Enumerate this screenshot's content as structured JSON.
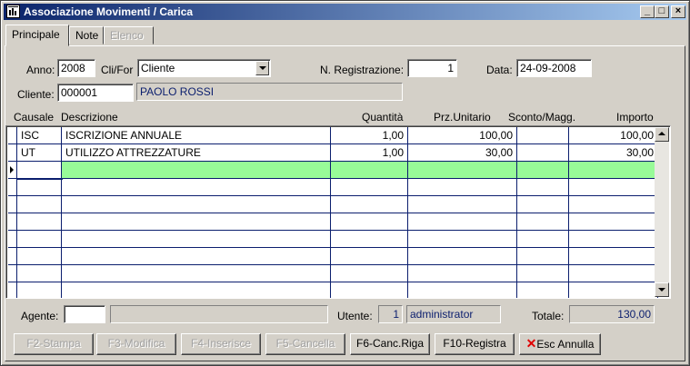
{
  "window": {
    "title": "Associazione Movimenti / Carica"
  },
  "tabs": [
    {
      "label": "Principale"
    },
    {
      "label": "Note"
    },
    {
      "label": "Elenco"
    }
  ],
  "form": {
    "anno_label": "Anno:",
    "anno_value": "2008",
    "clifor_label": "Cli/For",
    "clifor_value": "Cliente",
    "nreg_label": "N. Registrazione:",
    "nreg_value": "1",
    "data_label": "Data:",
    "data_value": "24-09-2008",
    "cliente_label": "Cliente:",
    "cliente_code": "000001",
    "cliente_name": "PAOLO ROSSI"
  },
  "grid": {
    "headers": [
      "Causale",
      "Descrizione",
      "Quantità",
      "Prz.Unitario",
      "Sconto/Magg.",
      "Importo"
    ],
    "rows": [
      [
        "ISC",
        "ISCRIZIONE ANNUALE",
        "1,00",
        "100,00",
        "",
        "100,00"
      ],
      [
        "UT",
        "UTILIZZO ATTREZZATURE",
        "1,00",
        "30,00",
        "",
        "30,00"
      ]
    ]
  },
  "footer": {
    "agente_label": "Agente:",
    "agente_value": "",
    "agente_desc": "",
    "utente_label": "Utente:",
    "utente_id": "1",
    "utente_name": "administrator",
    "totale_label": "Totale:",
    "totale_value": "130,00"
  },
  "buttons": {
    "stampa": "F2-Stampa",
    "modifica": "F3-Modifica",
    "inserisce": "F4-Inserisce",
    "cancella": "F5-Cancella",
    "canc_riga": "F6-Canc.Riga",
    "registra": "F10-Registra",
    "annulla_esc": "Esc",
    "annulla": "Annulla"
  }
}
